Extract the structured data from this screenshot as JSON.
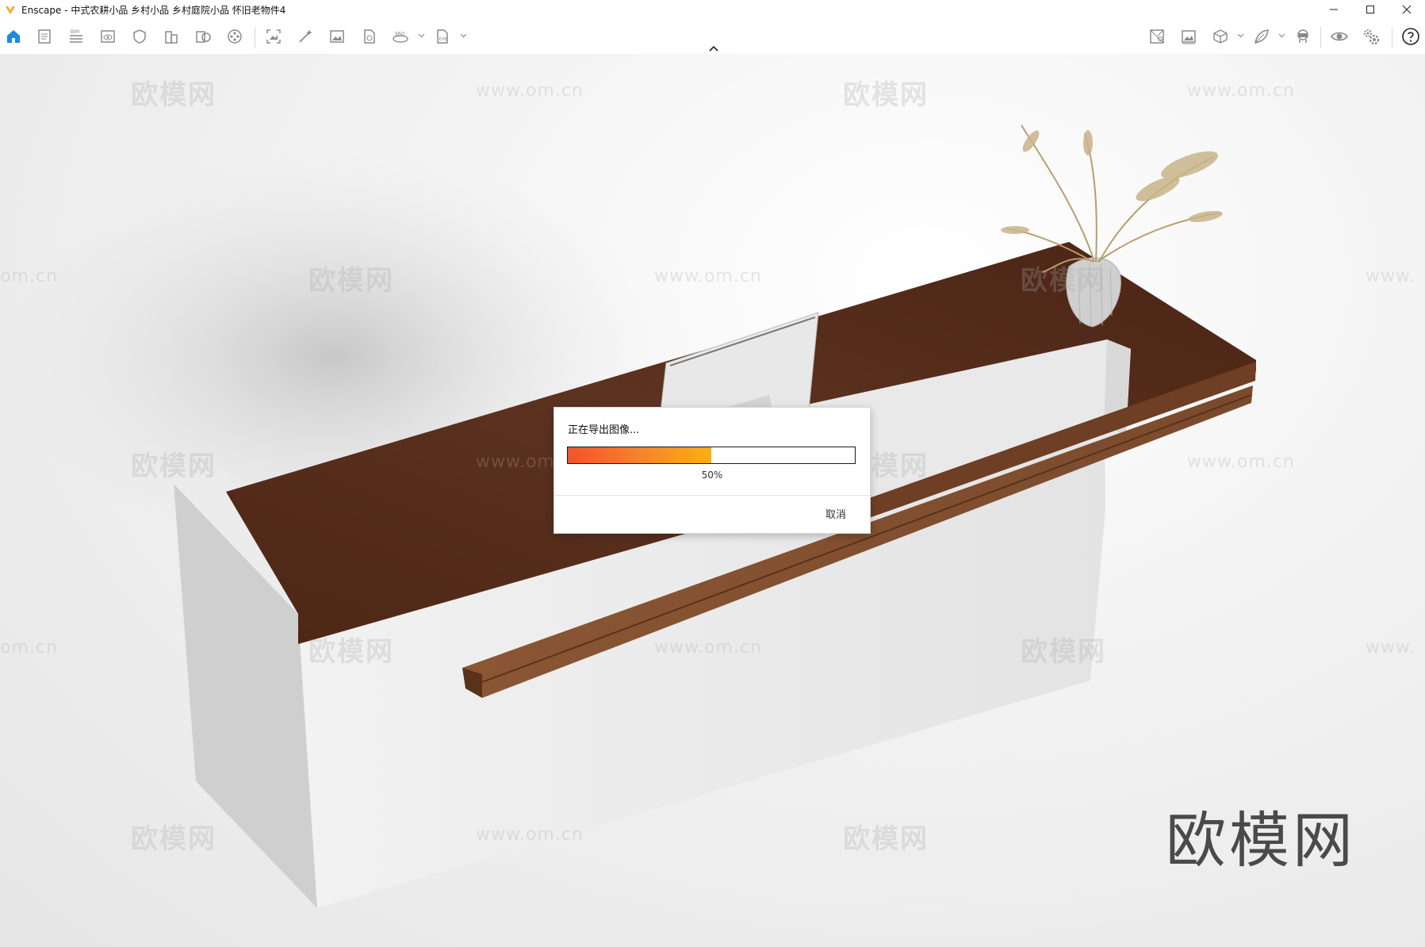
{
  "titlebar": {
    "title": "Enscape - 中式农耕小品 乡村小品 乡村庭院小品 怀旧老物件4",
    "logo": "enscape-logo",
    "controls": [
      "minimize-icon",
      "maximize-icon",
      "close-icon"
    ]
  },
  "toolbar": {
    "left_icons": [
      "home-icon",
      "document-icon",
      "bim-icon",
      "view-icon",
      "shield-icon",
      "building-icon",
      "asset-library-icon",
      "film-reel-icon",
      "screenshot-icon",
      "magic-wand-icon",
      "image-icon",
      "batch-render-icon",
      "panorama-360-icon",
      "exe-export-icon"
    ],
    "right_icons": [
      "map-icon",
      "gallery-icon",
      "box-icon",
      "leaf-icon",
      "vr-headset-icon",
      "eye-icon",
      "settings-icon",
      "help-icon"
    ]
  },
  "viewport": {
    "watermark_text": "欧模网",
    "watermark_url": "www.om.cn",
    "watermark_url_partial": "om.cn",
    "watermark_url_edge": "www.",
    "brand_text": "欧模网"
  },
  "dialog": {
    "title": "正在导出图像...",
    "progress_label": "50%",
    "progress_fraction": 0.5,
    "cancel_label": "取消"
  },
  "colors": {
    "accent": "#f7822a",
    "progress_start": "#f2532b",
    "progress_end": "#fcae14",
    "wood": "#5a2f1c",
    "logo": "#f5a623",
    "home_icon": "#1e88e5"
  }
}
